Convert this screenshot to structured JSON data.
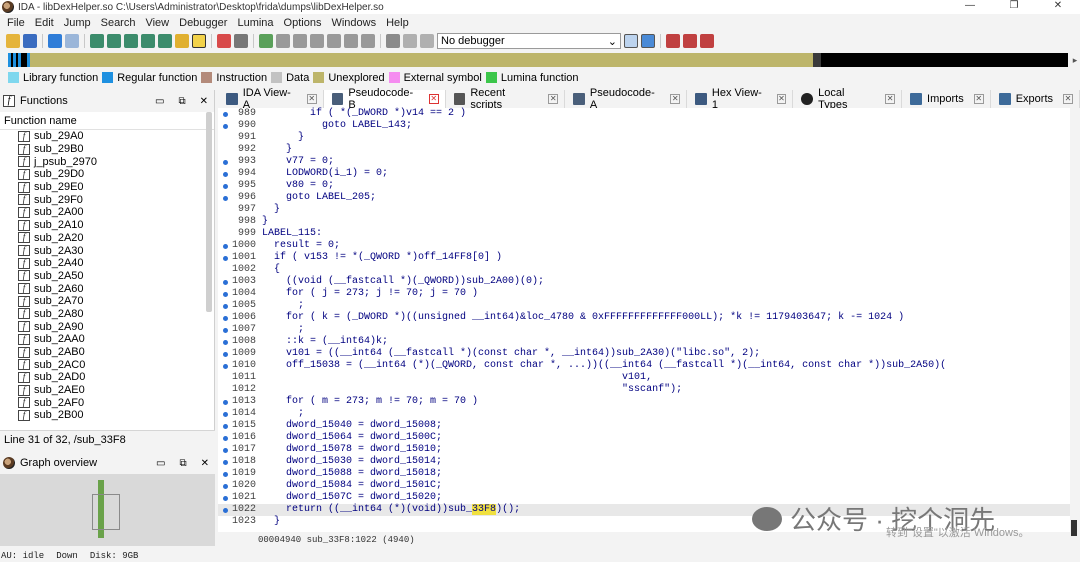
{
  "window": {
    "title": "IDA - libDexHelper.so C:\\Users\\Administrator\\Desktop\\frida\\dumps\\libDexHelper.so",
    "controls": [
      "—",
      "❐",
      "✕"
    ]
  },
  "menu": [
    "File",
    "Edit",
    "Jump",
    "Search",
    "View",
    "Debugger",
    "Lumina",
    "Options",
    "Windows",
    "Help"
  ],
  "toolbar": {
    "debugger_select": "No debugger"
  },
  "legend": [
    {
      "label": "Library function",
      "color": "#7fd7ee"
    },
    {
      "label": "Regular function",
      "color": "#1e90e0"
    },
    {
      "label": "Instruction",
      "color": "#b38a7a"
    },
    {
      "label": "Data",
      "color": "#c2c2c2"
    },
    {
      "label": "Unexplored",
      "color": "#bdb56a"
    },
    {
      "label": "External symbol",
      "color": "#f58cf0"
    },
    {
      "label": "Lumina function",
      "color": "#3cc64a"
    }
  ],
  "functions_panel": {
    "title": "Functions",
    "column": "Function name",
    "items": [
      "sub_29A0",
      "sub_29B0",
      "j_psub_2970",
      "sub_29D0",
      "sub_29E0",
      "sub_29F0",
      "sub_2A00",
      "sub_2A10",
      "sub_2A20",
      "sub_2A30",
      "sub_2A40",
      "sub_2A50",
      "sub_2A60",
      "sub_2A70",
      "sub_2A80",
      "sub_2A90",
      "sub_2AA0",
      "sub_2AB0",
      "sub_2AC0",
      "sub_2AD0",
      "sub_2AE0",
      "sub_2AF0",
      "sub_2B00"
    ],
    "status": "Line 31 of 32, /sub_33F8"
  },
  "graph_overview": {
    "title": "Graph overview"
  },
  "tabs": [
    {
      "label": "IDA View-A",
      "active": false
    },
    {
      "label": "Pseudocode-B",
      "active": true
    },
    {
      "label": "Recent scripts",
      "active": false
    },
    {
      "label": "Pseudocode-A",
      "active": false
    },
    {
      "label": "Hex View-1",
      "active": false
    },
    {
      "label": "Local Types",
      "active": false
    },
    {
      "label": "Imports",
      "active": false
    },
    {
      "label": "Exports",
      "active": false
    }
  ],
  "code_lines": [
    {
      "n": "989",
      "dot": true,
      "text": "        if ( *(_DWORD *)v14 == 2 )"
    },
    {
      "n": "990",
      "dot": true,
      "text": "          goto LABEL_143;"
    },
    {
      "n": "991",
      "dot": false,
      "text": "      }"
    },
    {
      "n": "992",
      "dot": false,
      "text": "    }"
    },
    {
      "n": "993",
      "dot": true,
      "text": "    v77 = 0;"
    },
    {
      "n": "994",
      "dot": true,
      "text": "    LODWORD(i_1) = 0;"
    },
    {
      "n": "995",
      "dot": true,
      "text": "    v80 = 0;"
    },
    {
      "n": "996",
      "dot": true,
      "text": "    goto LABEL_205;"
    },
    {
      "n": "997",
      "dot": false,
      "text": "  }"
    },
    {
      "n": "998",
      "dot": false,
      "text": "}"
    },
    {
      "n": "999",
      "dot": false,
      "text": "LABEL_115:"
    },
    {
      "n": "1000",
      "dot": true,
      "text": "  result = 0;"
    },
    {
      "n": "1001",
      "dot": true,
      "text": "  if ( v153 != *(_QWORD *)off_14FF8[0] )"
    },
    {
      "n": "1002",
      "dot": false,
      "text": "  {"
    },
    {
      "n": "1003",
      "dot": true,
      "text": "    ((void (__fastcall *)(_QWORD))sub_2A00)(0);"
    },
    {
      "n": "1004",
      "dot": true,
      "text": "    for ( j = 273; j != 70; j = 70 )"
    },
    {
      "n": "1005",
      "dot": true,
      "text": "      ;"
    },
    {
      "n": "1006",
      "dot": true,
      "text": "    for ( k = (_DWORD *)((unsigned __int64)&loc_4780 & 0xFFFFFFFFFFFFF000LL); *k != 1179403647; k -= 1024 )"
    },
    {
      "n": "1007",
      "dot": true,
      "text": "      ;"
    },
    {
      "n": "1008",
      "dot": true,
      "text": "    ::k = (__int64)k;"
    },
    {
      "n": "1009",
      "dot": true,
      "text": "    v101 = ((__int64 (__fastcall *)(const char *, __int64))sub_2A30)(\"libc.so\", 2);"
    },
    {
      "n": "1010",
      "dot": true,
      "text": "    off_15038 = (__int64 (*)(_QWORD, const char *, ...))((__int64 (__fastcall *)(__int64, const char *))sub_2A50)("
    },
    {
      "n": "1011",
      "dot": false,
      "text": "                                                            v101,"
    },
    {
      "n": "1012",
      "dot": false,
      "text": "                                                            \"sscanf\");"
    },
    {
      "n": "1013",
      "dot": true,
      "text": "    for ( m = 273; m != 70; m = 70 )"
    },
    {
      "n": "1014",
      "dot": true,
      "text": "      ;"
    },
    {
      "n": "1015",
      "dot": true,
      "text": "    dword_15040 = dword_15008;"
    },
    {
      "n": "1016",
      "dot": true,
      "text": "    dword_15064 = dword_1500C;"
    },
    {
      "n": "1017",
      "dot": true,
      "text": "    dword_15078 = dword_15010;"
    },
    {
      "n": "1018",
      "dot": true,
      "text": "    dword_15030 = dword_15014;"
    },
    {
      "n": "1019",
      "dot": true,
      "text": "    dword_15088 = dword_15018;"
    },
    {
      "n": "1020",
      "dot": true,
      "text": "    dword_15084 = dword_1501C;"
    },
    {
      "n": "1021",
      "dot": true,
      "text": "    dword_1507C = dword_15020;"
    },
    {
      "n": "1022",
      "dot": true,
      "text": "    return ((__int64 (*)(void))sub_33F8)();",
      "highlight": true,
      "hl_word": "33F8"
    },
    {
      "n": "1023",
      "dot": false,
      "text": "  }"
    }
  ],
  "code_status": "00004940 sub_33F8:1022 (4940)",
  "watermark": {
    "account": "公众号 · 挖个洞先",
    "activate": "转到\"设置\"以激活 Windows。"
  },
  "statusbar": [
    "AU:  idle",
    "Down",
    "Disk: 9GB"
  ]
}
